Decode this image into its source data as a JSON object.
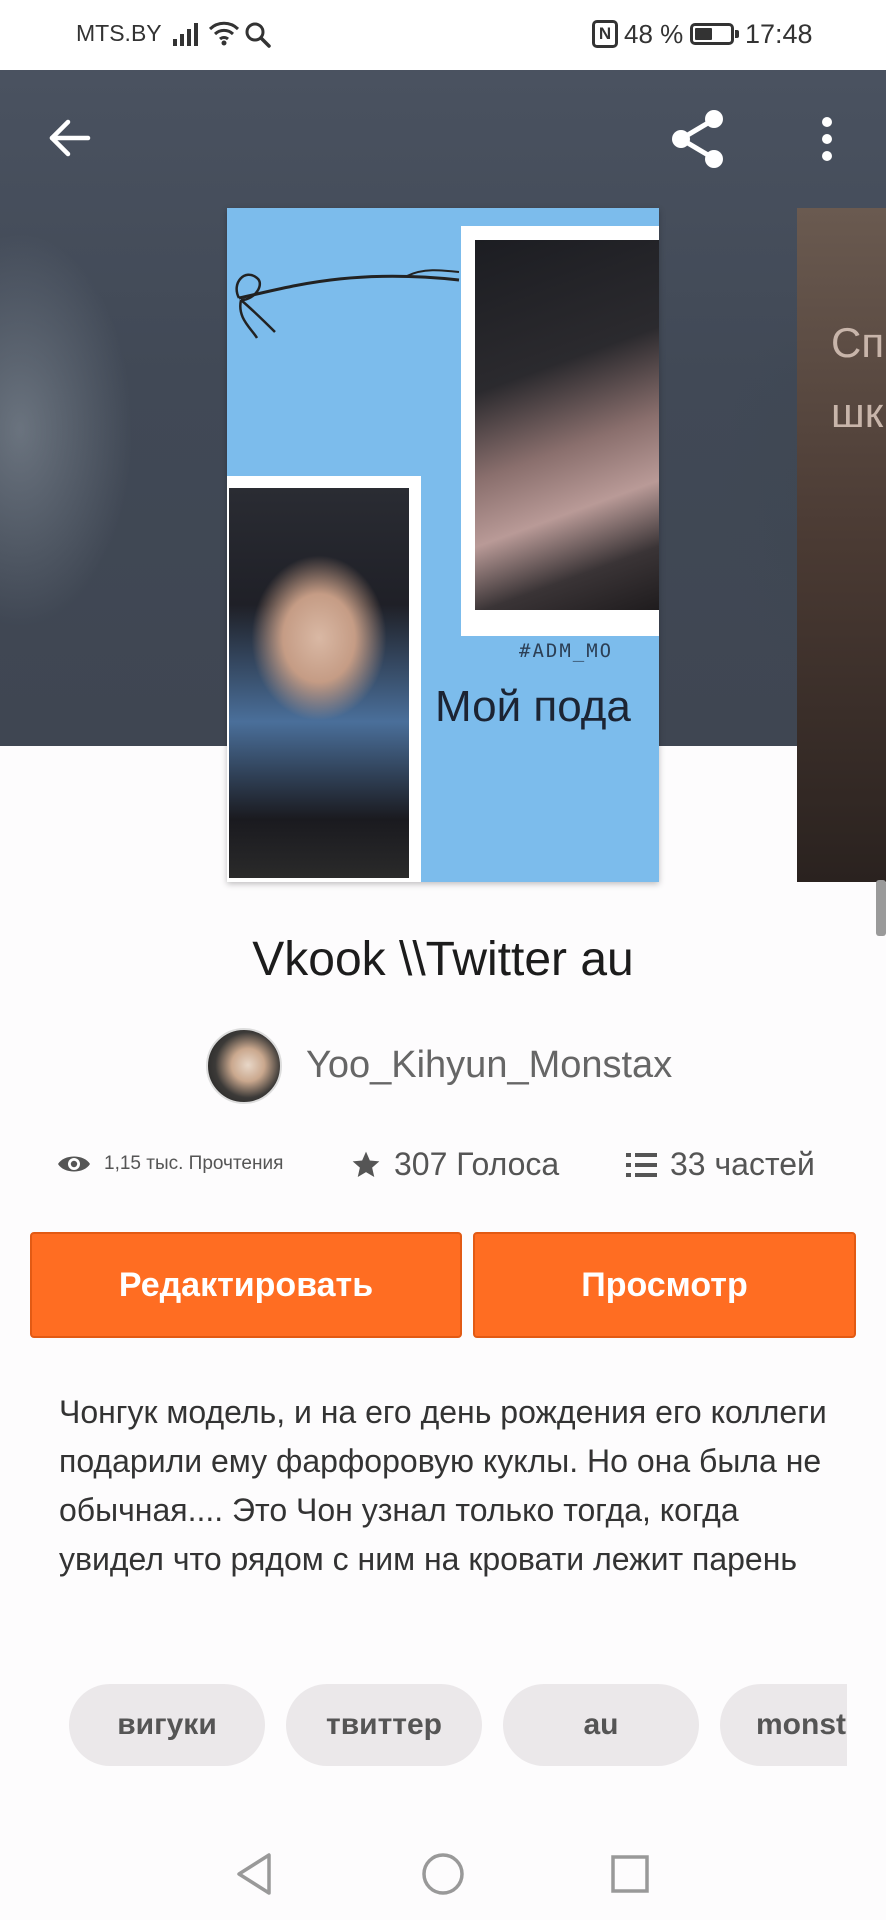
{
  "status_bar": {
    "carrier": "MTS.BY",
    "battery_percent": "48 %",
    "time": "17:48",
    "icons": [
      "signal-icon",
      "wifi-icon",
      "search-icon",
      "nfc-icon",
      "battery-icon"
    ]
  },
  "toolbar": {
    "icons": [
      "back-arrow-icon",
      "share-icon",
      "more-vertical-icon"
    ]
  },
  "cover": {
    "tag_text": "#ADM_MO",
    "title_text": "Мой пода"
  },
  "next_cover": {
    "text": "Сп\nшк"
  },
  "story": {
    "title": "Vkook \\\\Twitter au",
    "author": "Yoo_Kihyun_Monstax",
    "reads": "1,15 тыс. Прочтения",
    "votes": "307 Голоса",
    "parts": "33 частей",
    "description": "Чонгук модель, и на его день рождения его коллеги подарили ему фарфоровую куклы. Но она была не обычная.... Это Чон узнал только тогда, когда увидел что рядом с ним на кровати лежит парень"
  },
  "buttons": {
    "edit": "Редактировать",
    "view": "Просмотр"
  },
  "tags": [
    "вигуки",
    "твиттер",
    "au",
    "monst"
  ],
  "colors": {
    "accent": "#ff6d22",
    "tag_bg": "#ebe8ea"
  },
  "nav": {
    "icons": [
      "back-triangle-icon",
      "home-circle-icon",
      "recents-square-icon"
    ]
  }
}
